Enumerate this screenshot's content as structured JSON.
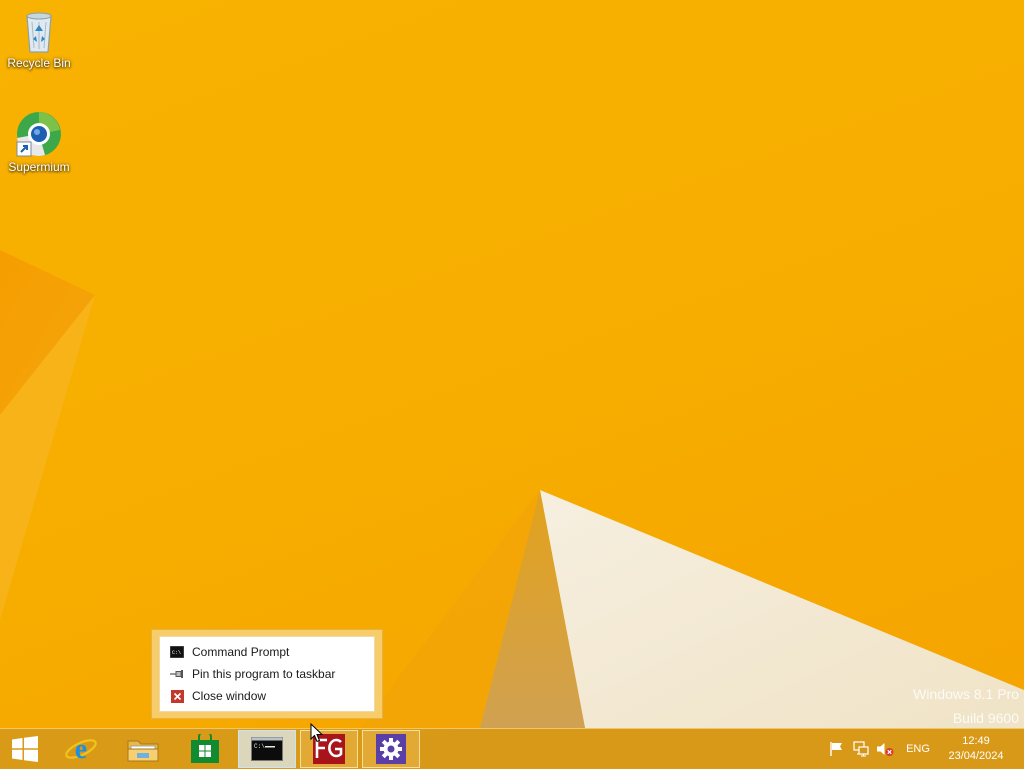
{
  "desktop": {
    "icons": [
      {
        "label": "Recycle Bin",
        "icon": "recycle-bin-icon"
      },
      {
        "label": "Supermium",
        "icon": "supermium-icon"
      }
    ],
    "watermark": {
      "line1": "Windows 8.1 Pro",
      "line2": "Build 9600"
    }
  },
  "jumplist": {
    "items": [
      {
        "label": "Command Prompt",
        "icon": "command-prompt-icon"
      },
      {
        "label": "Pin this program to taskbar",
        "icon": "pin-icon"
      },
      {
        "label": "Close window",
        "icon": "close-icon"
      }
    ]
  },
  "taskbar": {
    "buttons": [
      {
        "name": "start",
        "icon": "windows-logo-icon"
      },
      {
        "name": "internet-explorer",
        "icon": "internet-explorer-icon"
      },
      {
        "name": "file-explorer",
        "icon": "folder-icon"
      },
      {
        "name": "store",
        "icon": "store-icon"
      },
      {
        "name": "command-prompt",
        "icon": "command-prompt-icon"
      },
      {
        "name": "fg-app",
        "icon": "fg-app-icon"
      },
      {
        "name": "settings",
        "icon": "gear-icon"
      }
    ],
    "tray": {
      "language": "ENG",
      "time": "12:49",
      "date": "23/04/2024"
    }
  },
  "colors": {
    "wallpaper": "#f8b200",
    "taskbar": "#d2961e",
    "jumplist_border": "#f6cd6a"
  }
}
